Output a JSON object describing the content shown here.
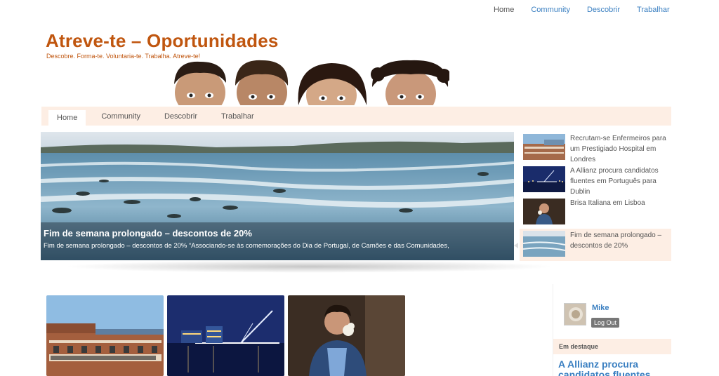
{
  "top_nav": [
    "Home",
    "Community",
    "Descobrir",
    "Trabalhar"
  ],
  "site": {
    "title": "Atreve-te – Oportunidades",
    "tagline": "Descobre. Forma-te. Voluntaria-te. Trabalha. Atreve-te!"
  },
  "main_menu": [
    {
      "label": "Home",
      "active": true
    },
    {
      "label": "Community",
      "active": false
    },
    {
      "label": "Descobrir",
      "active": false
    },
    {
      "label": "Trabalhar",
      "active": false
    }
  ],
  "slider": {
    "caption_title": "Fim de semana prolongado – descontos de 20%",
    "caption_text": "Fim de semana prolongado – descontos de 20% “Associando-se às comemorações do Dia de Portugal, de Camões e das Comunidades,"
  },
  "slider_thumbs": [
    {
      "label": "Recrutam-se Enfermeiros para um Prestigiado Hospital em Londres"
    },
    {
      "label": "A Allianz procura candidatos fluentes em Português para Dublin"
    },
    {
      "label": "Brisa Italiana em Lisboa"
    },
    {
      "label": "Fim de semana prolongado – descontos de 20%"
    }
  ],
  "user": {
    "name": "Mike",
    "logout_label": "Log Out"
  },
  "sidebar": {
    "featured_heading": "Em destaque",
    "featured_title": "A Allianz procura candidatos fluentes"
  },
  "colors": {
    "brand_orange": "#c0560f",
    "link_blue": "#3a7fc1",
    "menu_bg": "#fdeee4"
  }
}
